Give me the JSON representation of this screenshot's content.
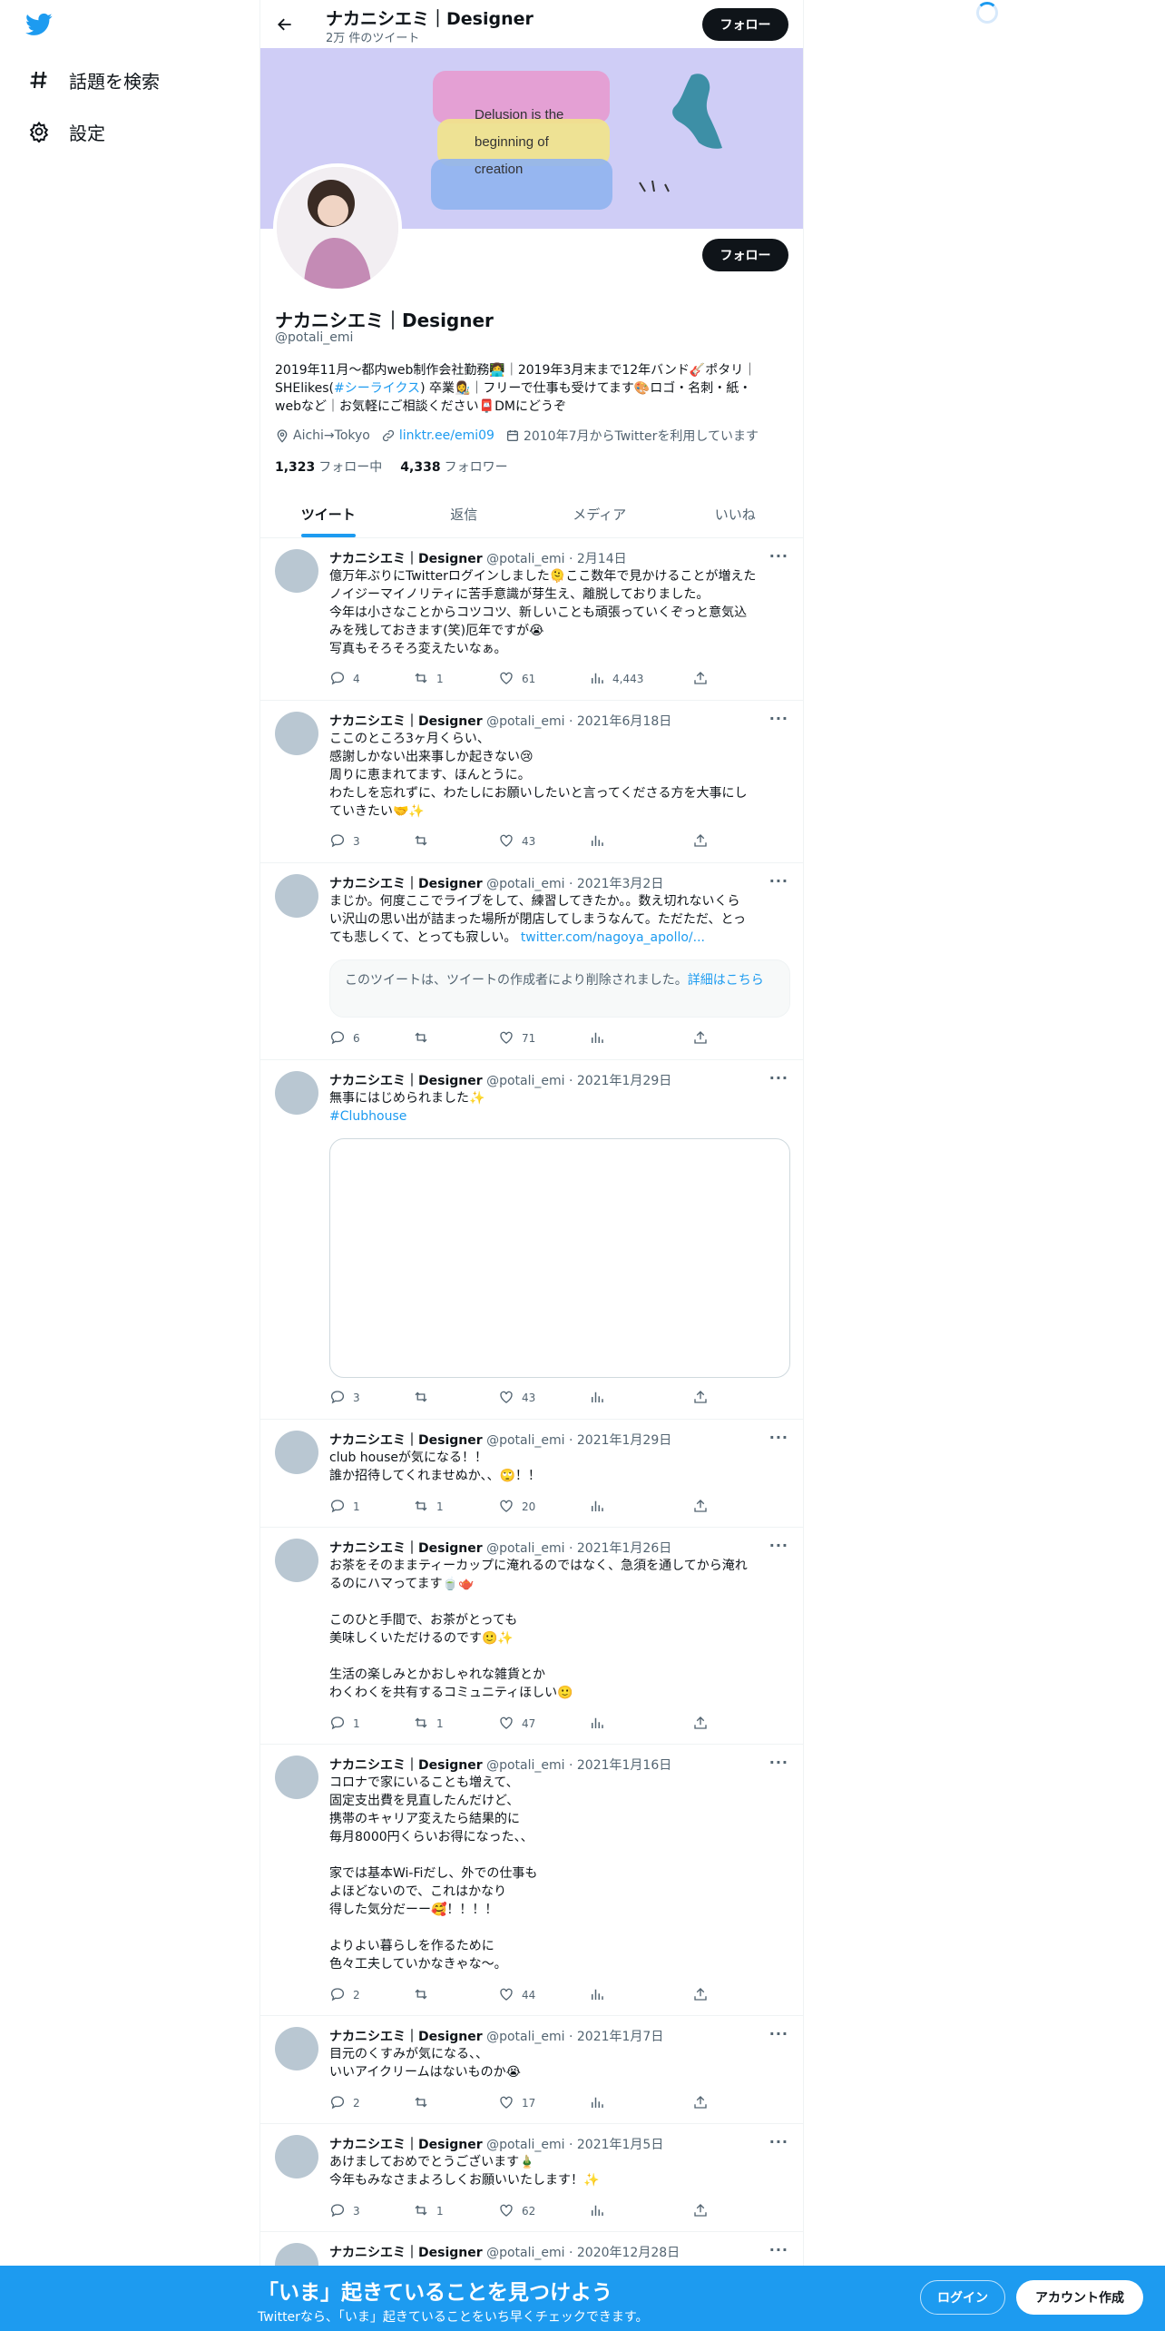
{
  "nav": {
    "search_label": "話題を検索",
    "settings_label": "設定"
  },
  "header": {
    "name": "ナカニシエミ｜Designer",
    "tweet_count": "2万 件のツイート",
    "follow_label": "フォロー"
  },
  "banner": {
    "line1": "Delusion is the",
    "line2": "beginning of",
    "line3": "creation"
  },
  "profile": {
    "name": "ナカニシエミ｜Designer",
    "handle": "@potali_emi",
    "follow_label": "フォロー",
    "bio_1": "2019年11月〜都内web制作会社勤務👩‍💻｜2019年3月末まで12年バンド🎸ポタリ｜",
    "bio_2a": "SHElikes(",
    "bio_2link": "#シーライクス",
    "bio_2b": ") 卒業👩‍🎨｜フリーで仕事も受けてます🎨ロゴ・名刺・紙・",
    "bio_3": "webなど｜お気軽にご相談ください📮DMにどうぞ",
    "location": "Aichi→Tokyo",
    "url": "linktr.ee/emi09",
    "joined": "2010年7月からTwitterを利用しています",
    "following_count": "1,323",
    "following_label": "フォロー中",
    "followers_count": "4,338",
    "followers_label": "フォロワー"
  },
  "tabs": [
    "ツイート",
    "返信",
    "メディア",
    "いいね"
  ],
  "tweet_author": {
    "name": "ナカニシエミ｜Designer",
    "handle": "@potali_emi"
  },
  "tweets": [
    {
      "date": "· 2月14日",
      "text": "億万年ぶりにTwitterログインしました🫠ここ数年で見かけることが増えた\nノイジーマイノリティに苦手意識が芽生え、離脱しておりました。\n今年は小さなことからコツコツ、新しいことも頑張っていくぞっと意気込\nみを残しておきます(笑)厄年ですが😭\n写真もそろそろ変えたいなぁ。",
      "replies": "4",
      "retweets": "1",
      "likes": "61",
      "views": "4,443"
    },
    {
      "date": "· 2021年6月18日",
      "text": "ここのところ3ヶ月くらい、\n感謝しかない出来事しか起きない😢\n周りに恵まれてます、ほんとうに。\nわたしを忘れずに、わたしにお願いしたいと言ってくださる方を大事にし\nていきたい🤝✨",
      "replies": "3",
      "retweets": "",
      "likes": "43",
      "views": ""
    },
    {
      "date": "· 2021年3月2日",
      "text": "まじか。何度ここでライブをして、練習してきたか。。数え切れないくら\nい沢山の思い出が詰まった場所が閉店してしまうなんて。ただただ、とっ\nても悲しくて、とっても寂しい。 ",
      "link": "twitter.com/nagoya_apollo/...",
      "deleted_text": "このツイートは、ツイートの作成者により削除されました。",
      "deleted_link": "詳細はこちら",
      "replies": "6",
      "retweets": "",
      "likes": "71",
      "views": ""
    },
    {
      "date": "· 2021年1月29日",
      "text": "無事にはじめられました✨",
      "hashtag": "#Clubhouse",
      "replies": "3",
      "retweets": "",
      "likes": "43",
      "views": ""
    },
    {
      "date": "· 2021年1月29日",
      "text": "club houseが気になる！！\n誰か招待してくれませぬか、、🙄！！",
      "replies": "1",
      "retweets": "1",
      "likes": "20",
      "views": ""
    },
    {
      "date": "· 2021年1月26日",
      "text": "お茶をそのままティーカップに淹れるのではなく、急須を通してから淹れ\nるのにハマってます🍵🫖\n\nこのひと手間で、お茶がとっても\n美味しくいただけるのです🙂✨\n\n生活の楽しみとかおしゃれな雑貨とか\nわくわくを共有するコミュニティほしい🙂",
      "replies": "1",
      "retweets": "1",
      "likes": "47",
      "views": ""
    },
    {
      "date": "· 2021年1月16日",
      "text": "コロナで家にいることも増えて、\n固定支出費を見直したんだけど、\n携帯のキャリア変えたら結果的に\n毎月8000円くらいお得になった、、\n\n家では基本Wi-Fiだし、外での仕事も\nよほどないので、これはかなり\n得した気分だーー🥰！！！！\n\nよりよい暮らしを作るために\n色々工夫していかなきゃな〜。",
      "replies": "2",
      "retweets": "",
      "likes": "44",
      "views": ""
    },
    {
      "date": "· 2021年1月7日",
      "text": "目元のくすみが気になる、、\nいいアイクリームはないものか😭",
      "replies": "2",
      "retweets": "",
      "likes": "17",
      "views": ""
    },
    {
      "date": "· 2021年1月5日",
      "text": "あけましておめでとうございます🎍\n今年もみなさまよろしくお願いいたします！✨",
      "replies": "3",
      "retweets": "1",
      "likes": "62",
      "views": ""
    },
    {
      "date": "· 2020年12月28日",
      "text": "",
      "replies": "",
      "retweets": "",
      "likes": "",
      "views": ""
    }
  ],
  "bottom": {
    "title": "「いま」起きていることを見つけよう",
    "subtitle": "Twitterなら、「いま」起きていることをいち早くチェックできます。",
    "login": "ログイン",
    "signup": "アカウント作成"
  },
  "colors": {
    "accent": "#1d9bf0",
    "text": "#0f1419",
    "secondary": "#536471",
    "banner": "#cfcdf6"
  }
}
